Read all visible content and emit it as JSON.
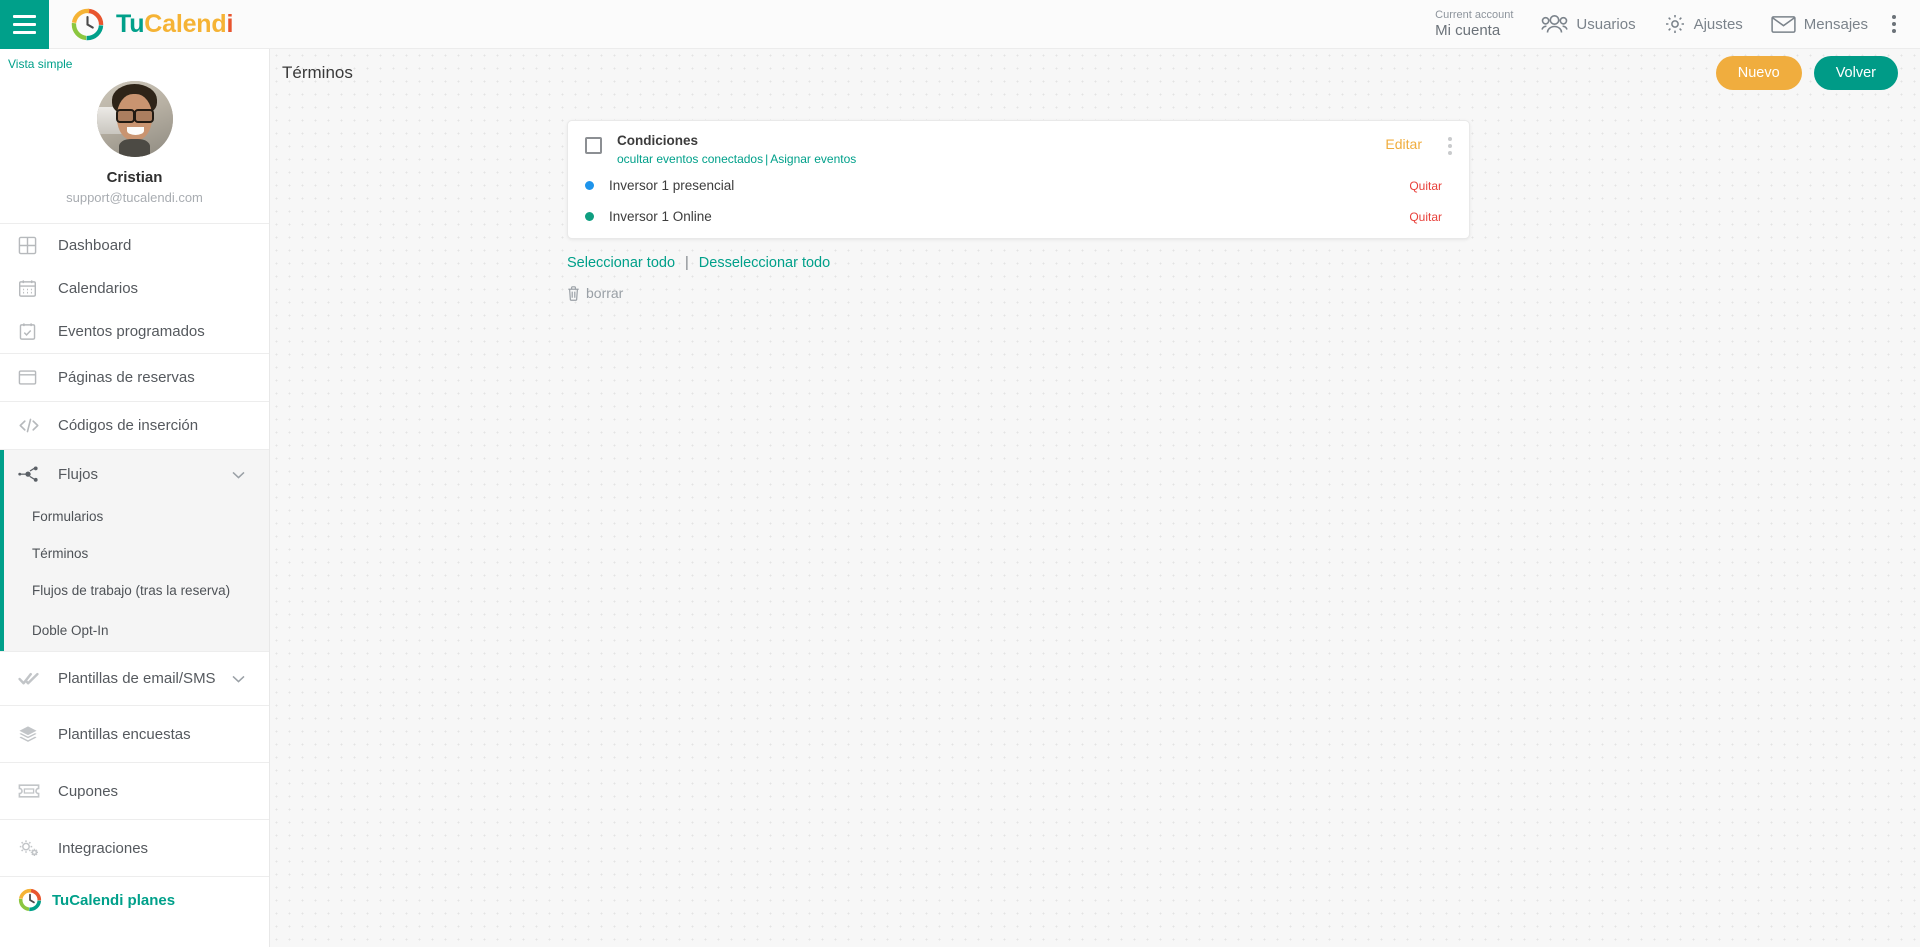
{
  "topbar": {
    "menu_icon": "hamburger-menu-icon",
    "brand": {
      "part1": "Tu",
      "part2": "Calend",
      "part3": "i",
      "logo_icon": "tucalendi-logo-icon"
    },
    "account": {
      "label": "Current account",
      "value": "Mi cuenta"
    },
    "nav": [
      {
        "label": "Usuarios",
        "icon": "users-icon"
      },
      {
        "label": "Ajustes",
        "icon": "gear-icon"
      },
      {
        "label": "Mensajes",
        "icon": "envelope-icon"
      }
    ],
    "kebab_icon": "vertical-dots-icon"
  },
  "sidebar": {
    "vista_simple": "Vista simple",
    "profile": {
      "name": "Cristian",
      "email": "support@tucalendi.com",
      "avatar": "user-avatar"
    },
    "items": [
      {
        "label": "Dashboard",
        "icon": "dashboard-grid-icon"
      },
      {
        "label": "Calendarios",
        "icon": "calendar-icon"
      },
      {
        "label": "Eventos programados",
        "icon": "calendar-check-icon"
      },
      {
        "label": "Páginas de reservas",
        "icon": "window-icon"
      },
      {
        "label": "Códigos de inserción",
        "icon": "code-icon"
      }
    ],
    "flujos": {
      "label": "Flujos",
      "icon": "flow-nodes-icon",
      "chevron": "chevron-down-icon",
      "sub": [
        {
          "label": "Formularios"
        },
        {
          "label": "Términos"
        },
        {
          "label": "Flujos de trabajo (tras la reserva)"
        },
        {
          "label": "Doble Opt-In"
        }
      ]
    },
    "items_bottom": [
      {
        "label": "Plantillas de email/SMS",
        "icon": "double-check-icon",
        "chevron": "chevron-down-icon"
      },
      {
        "label": "Plantillas encuestas",
        "icon": "layers-icon"
      },
      {
        "label": "Cupones",
        "icon": "ticket-icon"
      },
      {
        "label": "Integraciones",
        "icon": "gears-icon"
      }
    ],
    "plans": {
      "label": "TuCalendi planes",
      "icon": "tucalendi-logo-icon"
    }
  },
  "main": {
    "page_title": "Términos",
    "buttons": {
      "new": "Nuevo",
      "back": "Volver"
    },
    "card": {
      "checkbox_checked": false,
      "title": "Condiciones",
      "link_hide": "ocultar eventos conectados",
      "link_sep": "|",
      "link_assign": "Asignar eventos",
      "edit": "Editar",
      "kebab_icon": "vertical-dots-icon",
      "events": [
        {
          "name": "Inversor 1 presencial",
          "color": "#1E94EB",
          "remove": "Quitar"
        },
        {
          "name": "Inversor 1 Online",
          "color": "#0E9E80",
          "remove": "Quitar"
        }
      ]
    },
    "select_all": "Seleccionar todo",
    "select_sep": "|",
    "deselect_all": "Desseleccionar todo",
    "delete": {
      "label": "borrar",
      "icon": "trash-icon"
    }
  },
  "colors": {
    "teal": "#00a08a",
    "orange": "#f0ad3e",
    "red": "#e8403a",
    "blue_dot": "#1E94EB",
    "green_dot": "#0E9E80"
  }
}
